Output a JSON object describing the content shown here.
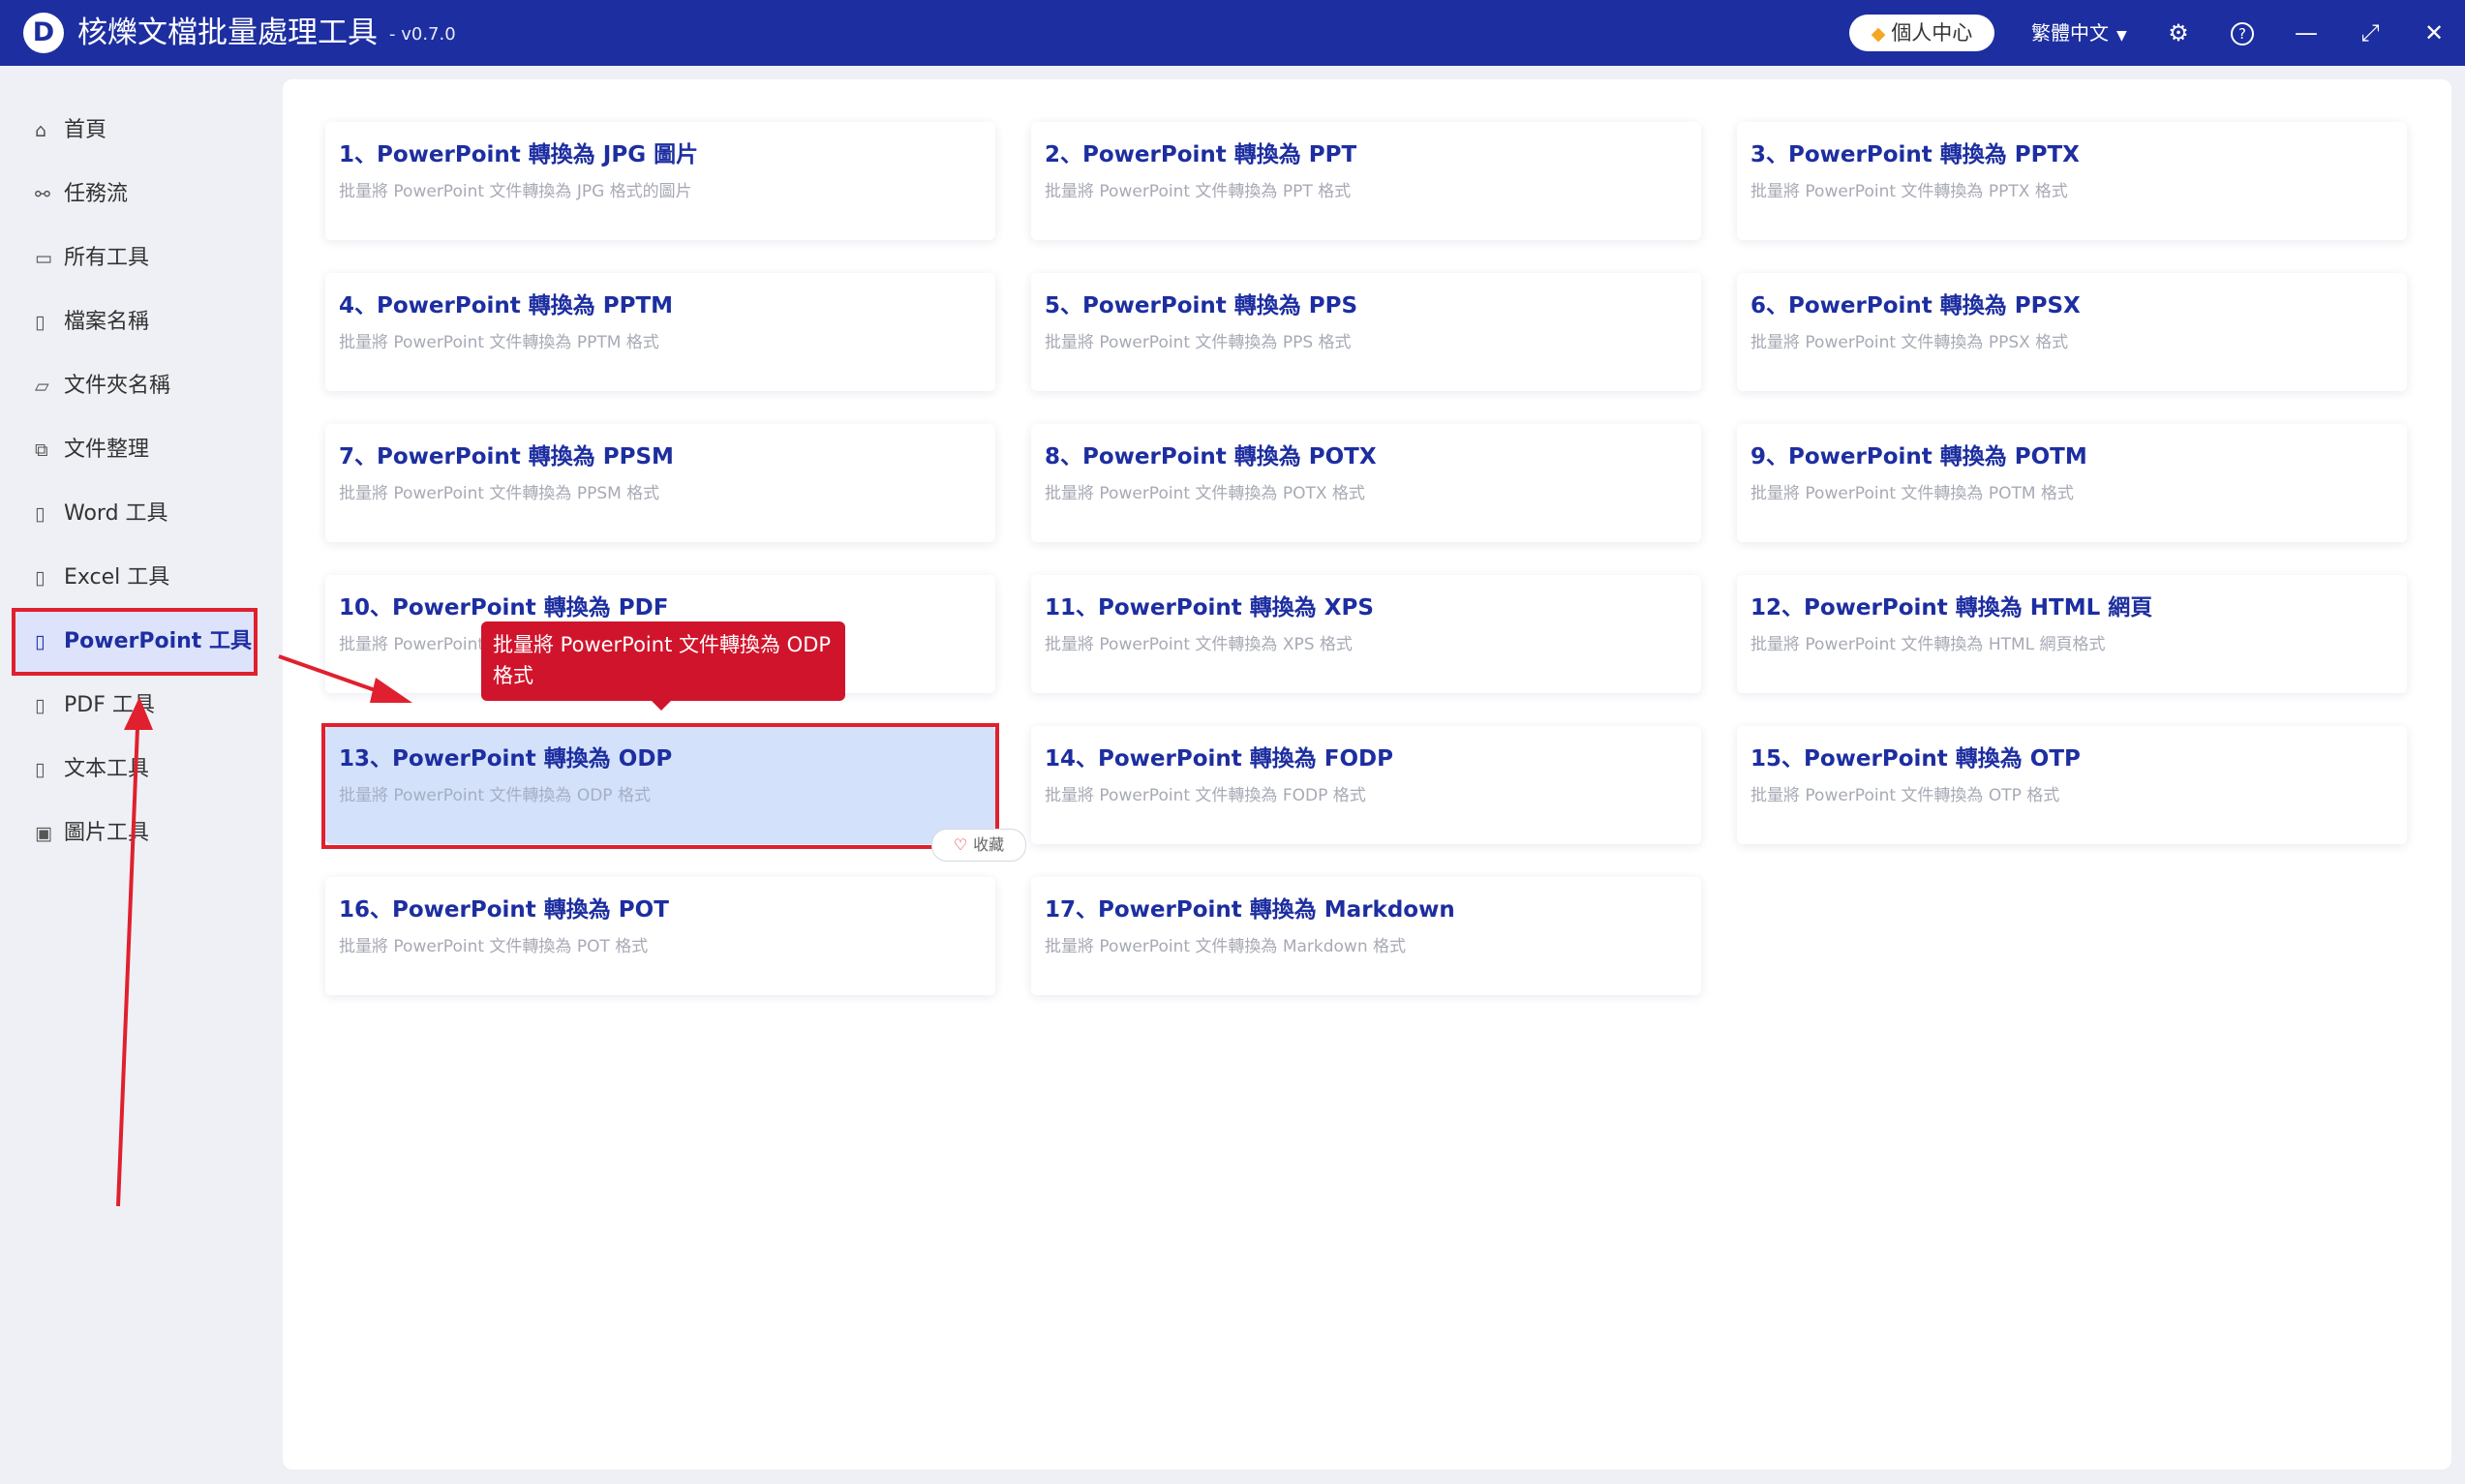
{
  "app": {
    "logo_letter": "D",
    "title": "核爍文檔批量處理工具",
    "version": "- v0.7.0",
    "user_center": "個人中心",
    "language": "繁體中文"
  },
  "window_controls": [
    "settings-icon",
    "help-icon",
    "minimize-icon",
    "maximize-icon",
    "close-icon"
  ],
  "sidebar": {
    "items": [
      {
        "label": "首頁",
        "icon": "home-icon"
      },
      {
        "label": "任務流",
        "icon": "workflow-icon"
      },
      {
        "label": "所有工具",
        "icon": "monitor-icon"
      },
      {
        "label": "檔案名稱",
        "icon": "file-icon"
      },
      {
        "label": "文件夾名稱",
        "icon": "folder-icon"
      },
      {
        "label": "文件整理",
        "icon": "organize-icon"
      },
      {
        "label": "Word 工具",
        "icon": "word-icon"
      },
      {
        "label": "Excel 工具",
        "icon": "excel-icon"
      },
      {
        "label": "PowerPoint 工具",
        "icon": "powerpoint-icon",
        "active": true
      },
      {
        "label": "PDF 工具",
        "icon": "pdf-icon"
      },
      {
        "label": "文本工具",
        "icon": "text-icon"
      },
      {
        "label": "圖片工具",
        "icon": "image-icon"
      }
    ]
  },
  "tools": [
    {
      "title": "1、PowerPoint 轉換為 JPG 圖片",
      "desc": "批量將 PowerPoint 文件轉換為 JPG 格式的圖片"
    },
    {
      "title": "2、PowerPoint 轉換為 PPT",
      "desc": "批量將 PowerPoint 文件轉換為 PPT 格式"
    },
    {
      "title": "3、PowerPoint 轉換為 PPTX",
      "desc": "批量將 PowerPoint 文件轉換為 PPTX 格式"
    },
    {
      "title": "4、PowerPoint 轉換為 PPTM",
      "desc": "批量將 PowerPoint 文件轉換為 PPTM 格式"
    },
    {
      "title": "5、PowerPoint 轉換為 PPS",
      "desc": "批量將 PowerPoint 文件轉換為 PPS 格式"
    },
    {
      "title": "6、PowerPoint 轉換為 PPSX",
      "desc": "批量將 PowerPoint 文件轉換為 PPSX 格式"
    },
    {
      "title": "7、PowerPoint 轉換為 PPSM",
      "desc": "批量將 PowerPoint 文件轉換為 PPSM 格式"
    },
    {
      "title": "8、PowerPoint 轉換為 POTX",
      "desc": "批量將 PowerPoint 文件轉換為 POTX 格式"
    },
    {
      "title": "9、PowerPoint 轉換為 POTM",
      "desc": "批量將 PowerPoint 文件轉換為 POTM 格式"
    },
    {
      "title": "10、PowerPoint 轉換為 PDF",
      "desc": "批量將 PowerPoint"
    },
    {
      "title": "11、PowerPoint 轉換為 XPS",
      "desc": "批量將 PowerPoint 文件轉換為 XPS 格式"
    },
    {
      "title": "12、PowerPoint 轉換為 HTML 網頁",
      "desc": "批量將 PowerPoint 文件轉換為 HTML 網頁格式"
    },
    {
      "title": "13、PowerPoint 轉換為 ODP",
      "desc": "批量將 PowerPoint 文件轉換為 ODP 格式",
      "highlighted": true
    },
    {
      "title": "14、PowerPoint 轉換為 FODP",
      "desc": "批量將 PowerPoint 文件轉換為 FODP 格式"
    },
    {
      "title": "15、PowerPoint 轉換為 OTP",
      "desc": "批量將 PowerPoint 文件轉換為 OTP 格式"
    },
    {
      "title": "16、PowerPoint 轉換為 POT",
      "desc": "批量將 PowerPoint 文件轉換為 POT 格式"
    },
    {
      "title": "17、PowerPoint 轉換為 Markdown",
      "desc": "批量將 PowerPoint 文件轉換為 Markdown 格式"
    }
  ],
  "favorite_label": "收藏",
  "tooltip": "批量將 PowerPoint 文件轉換為 ODP 格式",
  "colors": {
    "brand": "#1d2ea0",
    "annotation_red": "#e0202e",
    "highlight_bg": "#d3e1fb"
  }
}
